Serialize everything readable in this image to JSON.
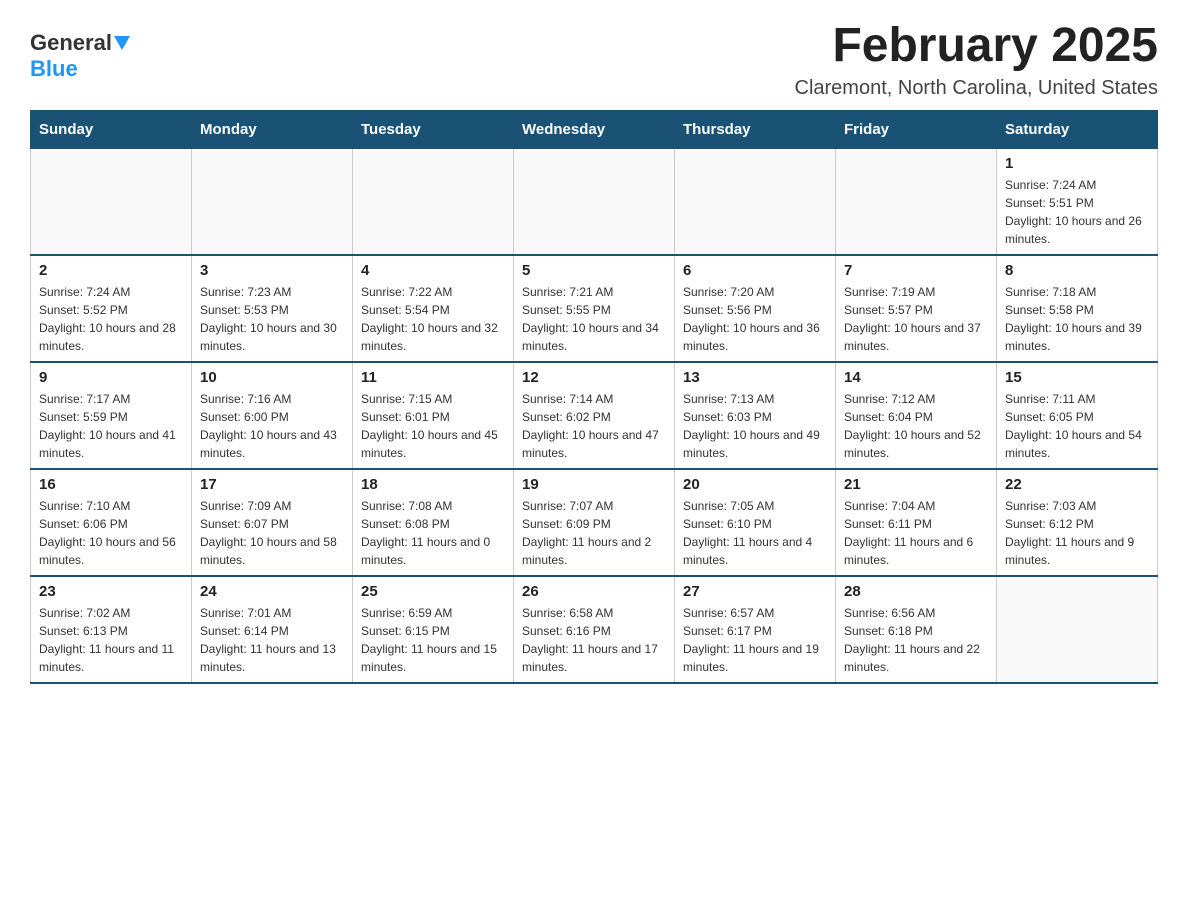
{
  "logo": {
    "text_general": "General",
    "text_blue": "Blue"
  },
  "title": "February 2025",
  "location": "Claremont, North Carolina, United States",
  "days_of_week": [
    "Sunday",
    "Monday",
    "Tuesday",
    "Wednesday",
    "Thursday",
    "Friday",
    "Saturday"
  ],
  "weeks": [
    [
      {
        "day": "",
        "info": ""
      },
      {
        "day": "",
        "info": ""
      },
      {
        "day": "",
        "info": ""
      },
      {
        "day": "",
        "info": ""
      },
      {
        "day": "",
        "info": ""
      },
      {
        "day": "",
        "info": ""
      },
      {
        "day": "1",
        "info": "Sunrise: 7:24 AM\nSunset: 5:51 PM\nDaylight: 10 hours and 26 minutes."
      }
    ],
    [
      {
        "day": "2",
        "info": "Sunrise: 7:24 AM\nSunset: 5:52 PM\nDaylight: 10 hours and 28 minutes."
      },
      {
        "day": "3",
        "info": "Sunrise: 7:23 AM\nSunset: 5:53 PM\nDaylight: 10 hours and 30 minutes."
      },
      {
        "day": "4",
        "info": "Sunrise: 7:22 AM\nSunset: 5:54 PM\nDaylight: 10 hours and 32 minutes."
      },
      {
        "day": "5",
        "info": "Sunrise: 7:21 AM\nSunset: 5:55 PM\nDaylight: 10 hours and 34 minutes."
      },
      {
        "day": "6",
        "info": "Sunrise: 7:20 AM\nSunset: 5:56 PM\nDaylight: 10 hours and 36 minutes."
      },
      {
        "day": "7",
        "info": "Sunrise: 7:19 AM\nSunset: 5:57 PM\nDaylight: 10 hours and 37 minutes."
      },
      {
        "day": "8",
        "info": "Sunrise: 7:18 AM\nSunset: 5:58 PM\nDaylight: 10 hours and 39 minutes."
      }
    ],
    [
      {
        "day": "9",
        "info": "Sunrise: 7:17 AM\nSunset: 5:59 PM\nDaylight: 10 hours and 41 minutes."
      },
      {
        "day": "10",
        "info": "Sunrise: 7:16 AM\nSunset: 6:00 PM\nDaylight: 10 hours and 43 minutes."
      },
      {
        "day": "11",
        "info": "Sunrise: 7:15 AM\nSunset: 6:01 PM\nDaylight: 10 hours and 45 minutes."
      },
      {
        "day": "12",
        "info": "Sunrise: 7:14 AM\nSunset: 6:02 PM\nDaylight: 10 hours and 47 minutes."
      },
      {
        "day": "13",
        "info": "Sunrise: 7:13 AM\nSunset: 6:03 PM\nDaylight: 10 hours and 49 minutes."
      },
      {
        "day": "14",
        "info": "Sunrise: 7:12 AM\nSunset: 6:04 PM\nDaylight: 10 hours and 52 minutes."
      },
      {
        "day": "15",
        "info": "Sunrise: 7:11 AM\nSunset: 6:05 PM\nDaylight: 10 hours and 54 minutes."
      }
    ],
    [
      {
        "day": "16",
        "info": "Sunrise: 7:10 AM\nSunset: 6:06 PM\nDaylight: 10 hours and 56 minutes."
      },
      {
        "day": "17",
        "info": "Sunrise: 7:09 AM\nSunset: 6:07 PM\nDaylight: 10 hours and 58 minutes."
      },
      {
        "day": "18",
        "info": "Sunrise: 7:08 AM\nSunset: 6:08 PM\nDaylight: 11 hours and 0 minutes."
      },
      {
        "day": "19",
        "info": "Sunrise: 7:07 AM\nSunset: 6:09 PM\nDaylight: 11 hours and 2 minutes."
      },
      {
        "day": "20",
        "info": "Sunrise: 7:05 AM\nSunset: 6:10 PM\nDaylight: 11 hours and 4 minutes."
      },
      {
        "day": "21",
        "info": "Sunrise: 7:04 AM\nSunset: 6:11 PM\nDaylight: 11 hours and 6 minutes."
      },
      {
        "day": "22",
        "info": "Sunrise: 7:03 AM\nSunset: 6:12 PM\nDaylight: 11 hours and 9 minutes."
      }
    ],
    [
      {
        "day": "23",
        "info": "Sunrise: 7:02 AM\nSunset: 6:13 PM\nDaylight: 11 hours and 11 minutes."
      },
      {
        "day": "24",
        "info": "Sunrise: 7:01 AM\nSunset: 6:14 PM\nDaylight: 11 hours and 13 minutes."
      },
      {
        "day": "25",
        "info": "Sunrise: 6:59 AM\nSunset: 6:15 PM\nDaylight: 11 hours and 15 minutes."
      },
      {
        "day": "26",
        "info": "Sunrise: 6:58 AM\nSunset: 6:16 PM\nDaylight: 11 hours and 17 minutes."
      },
      {
        "day": "27",
        "info": "Sunrise: 6:57 AM\nSunset: 6:17 PM\nDaylight: 11 hours and 19 minutes."
      },
      {
        "day": "28",
        "info": "Sunrise: 6:56 AM\nSunset: 6:18 PM\nDaylight: 11 hours and 22 minutes."
      },
      {
        "day": "",
        "info": ""
      }
    ]
  ]
}
